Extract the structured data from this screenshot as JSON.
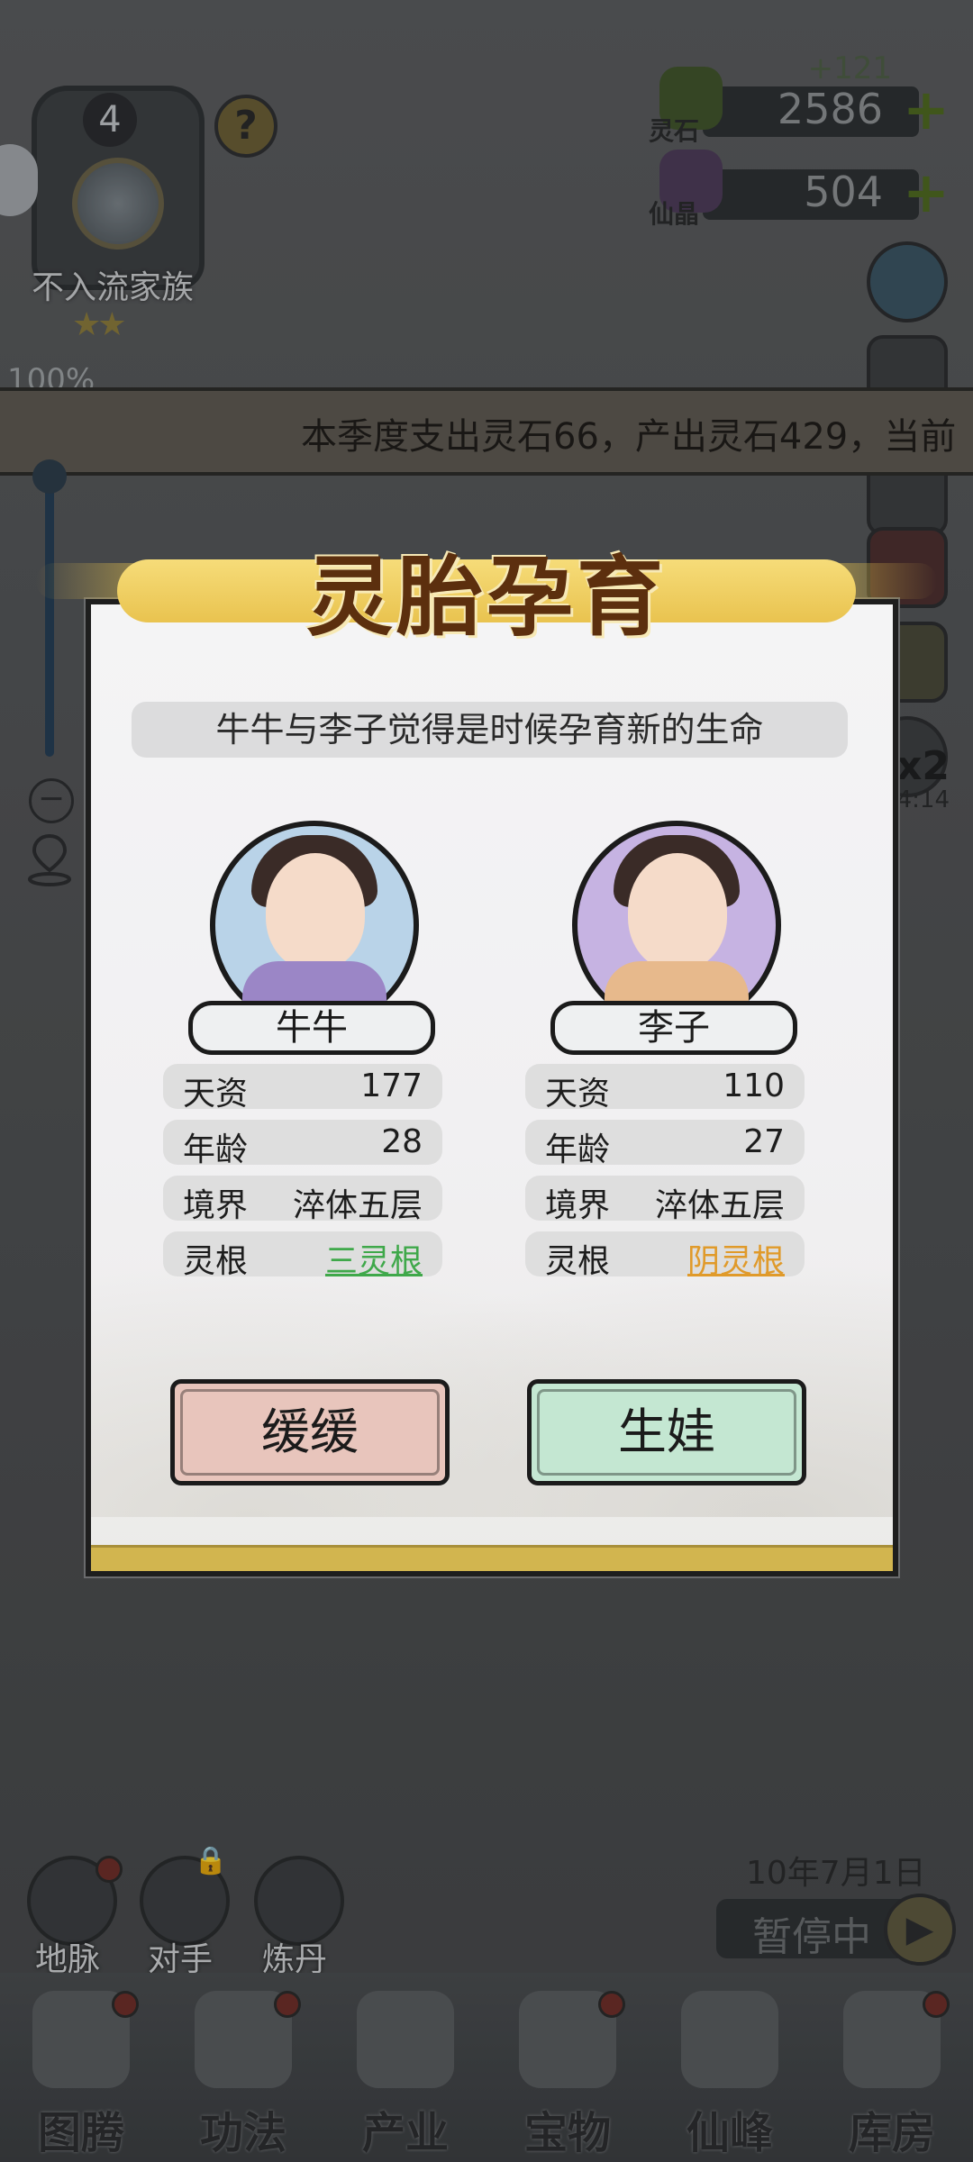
{
  "family": {
    "level": "4",
    "name": "不入流家族",
    "stars": "★★",
    "progress": "100%"
  },
  "resources": {
    "spirit_stone": {
      "label": "灵石",
      "value": "2586",
      "gain": "+121"
    },
    "immortal_crystal": {
      "label": "仙晶",
      "value": "504"
    },
    "plus": "+"
  },
  "ticker": {
    "text": "本季度支出灵石66，产出灵石429，当前"
  },
  "speed": {
    "multiplier": "x2",
    "timer": "4:14"
  },
  "date": "10年7月1日",
  "pause": {
    "label": "暂停中"
  },
  "features": [
    {
      "label": "地脉"
    },
    {
      "label": "对手"
    },
    {
      "label": "炼丹"
    }
  ],
  "nav": [
    {
      "label": "图腾"
    },
    {
      "label": "功法"
    },
    {
      "label": "产业"
    },
    {
      "label": "宝物"
    },
    {
      "label": "仙峰"
    },
    {
      "label": "库房"
    }
  ],
  "modal": {
    "title": "灵胎孕育",
    "prompt": "牛牛与李子觉得是时候孕育新的生命",
    "left": {
      "name": "牛牛",
      "stats": [
        {
          "k": "天资",
          "v": "177"
        },
        {
          "k": "年龄",
          "v": "28"
        },
        {
          "k": "境界",
          "v": "淬体五层"
        },
        {
          "k": "灵根",
          "v": "三灵根"
        }
      ]
    },
    "right": {
      "name": "李子",
      "stats": [
        {
          "k": "天资",
          "v": "110"
        },
        {
          "k": "年龄",
          "v": "27"
        },
        {
          "k": "境界",
          "v": "淬体五层"
        },
        {
          "k": "灵根",
          "v": "阴灵根"
        }
      ]
    },
    "buttons": {
      "slow": "缓缓",
      "baby": "生娃"
    }
  }
}
